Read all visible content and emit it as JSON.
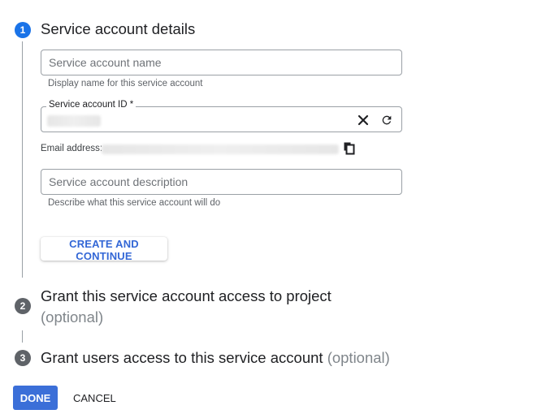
{
  "steps": [
    {
      "number": "1",
      "title": "Service account details",
      "optional": "",
      "state": "active"
    },
    {
      "number": "2",
      "title": "Grant this service account access to project",
      "optional": "(optional)",
      "state": "inactive"
    },
    {
      "number": "3",
      "title": "Grant users access to this service account",
      "optional": "(optional)",
      "state": "inactive"
    }
  ],
  "form": {
    "name_field": {
      "placeholder": "Service account name",
      "value": "",
      "hint": "Display name for this service account"
    },
    "id_field": {
      "label": "Service account ID *",
      "value": ""
    },
    "email": {
      "label": "Email address:"
    },
    "description_field": {
      "placeholder": "Service account description",
      "value": "",
      "hint": "Describe what this service account will do"
    },
    "create_button": "CREATE AND CONTINUE"
  },
  "icons": {
    "clear": "close-icon",
    "refresh": "refresh-icon",
    "copy": "copy-icon"
  },
  "footer": {
    "done_button": "DONE",
    "cancel_button": "CANCEL"
  },
  "colors": {
    "accent": "#1a73e8",
    "primary_button": "#3b6fd8",
    "link_text": "#3367d6"
  }
}
